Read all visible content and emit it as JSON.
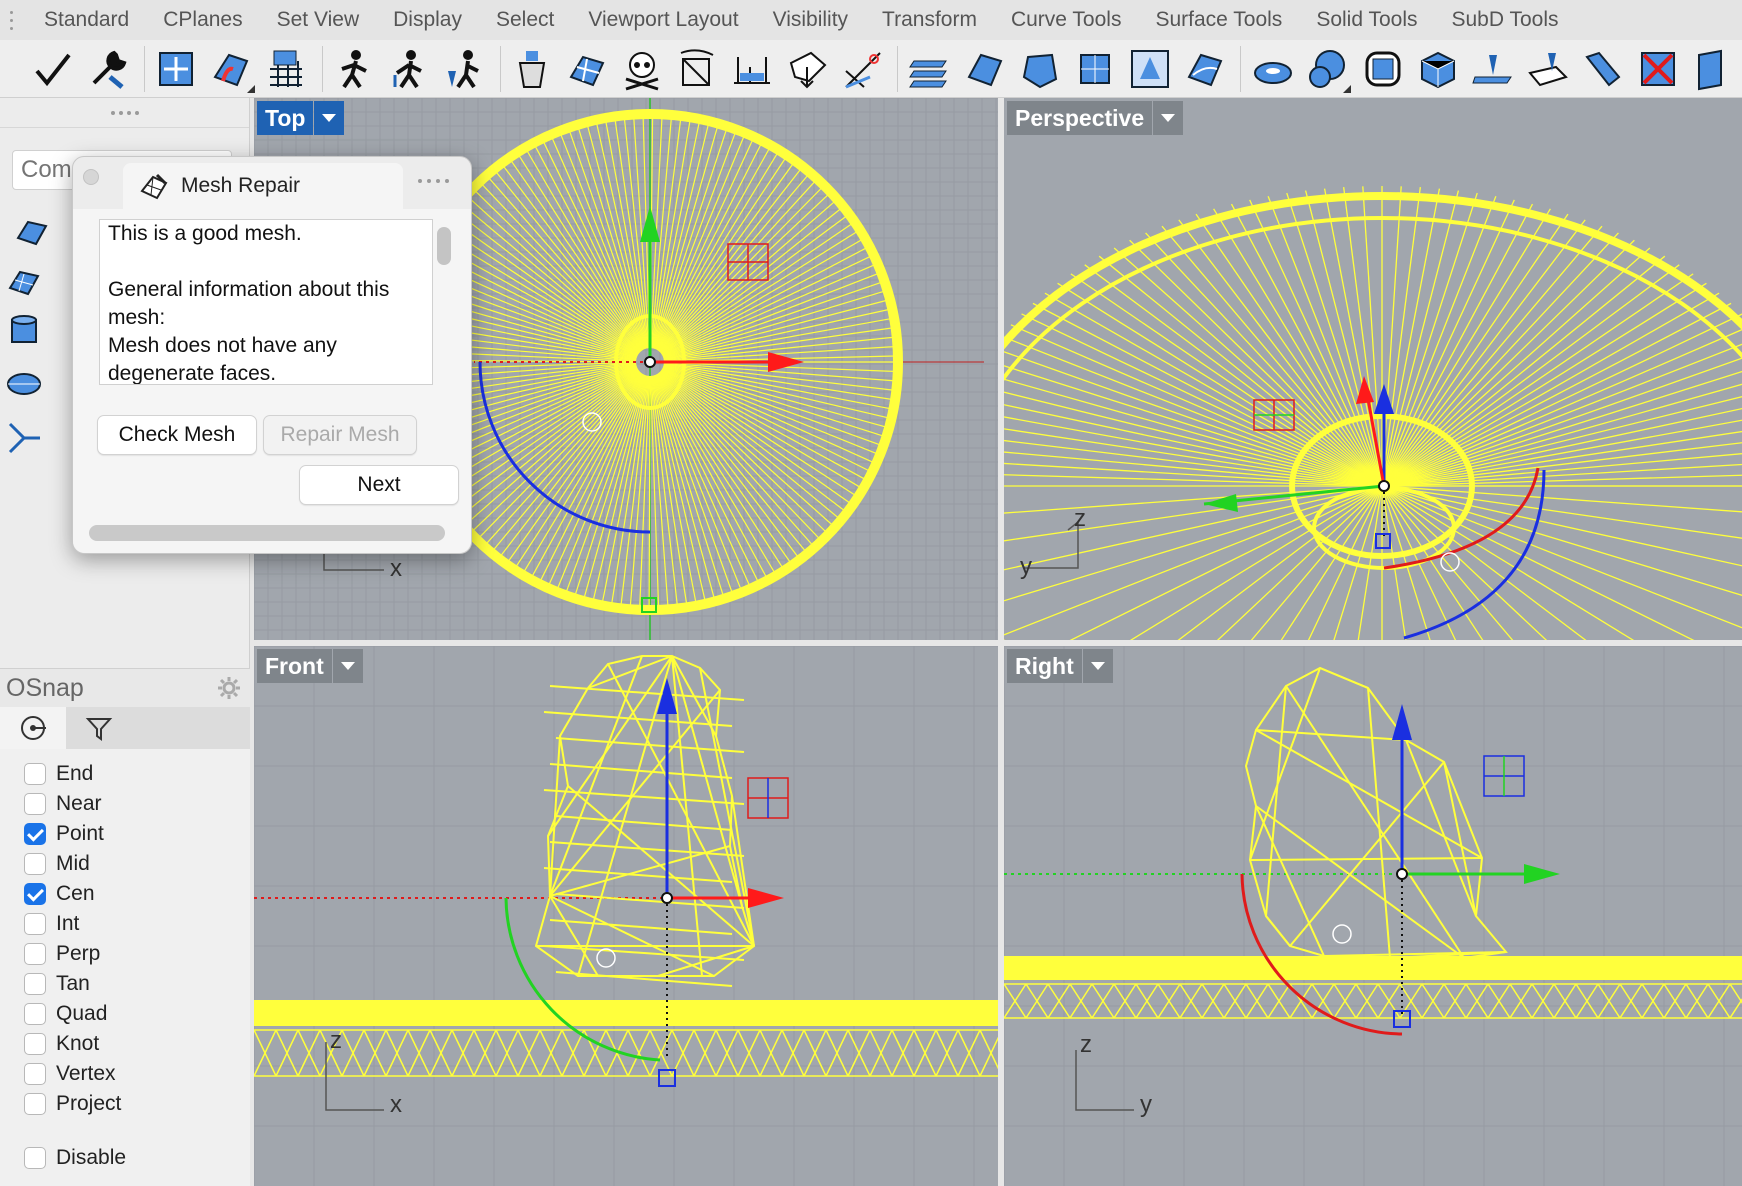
{
  "tabs": [
    "Standard",
    "CPlanes",
    "Set View",
    "Display",
    "Select",
    "Viewport Layout",
    "Visibility",
    "Transform",
    "Curve Tools",
    "Surface Tools",
    "Solid Tools",
    "SubD Tools"
  ],
  "toolbar_icons": [
    "checkmark-icon",
    "wrench-icon",
    "gumball-icon",
    "paint-surface-icon",
    "grid-snap-icon",
    "person-move-icon",
    "person-scale-icon",
    "person-rotate-icon",
    "bucket-icon",
    "mesh-patch-icon",
    "skull-icon",
    "frame-icon",
    "dimension-icon",
    "surface-outline-icon",
    "cut-icon",
    "mesh-layers-icon",
    "mesh-tile-icon",
    "mesh-shape-icon",
    "mesh-box-icon",
    "mesh-select-icon",
    "mesh-curve-icon",
    "torus-icon",
    "sphere-icon",
    "box-icon",
    "cube-mesh-icon",
    "plane-point-icon",
    "plane-flip-icon",
    "bend-icon",
    "red-cross-icon",
    "slab-icon"
  ],
  "sidebar": {
    "command_placeholder": "Com",
    "tools": [
      "surface-icon",
      "mesh-plane-icon",
      "cylinder-icon",
      "ellipsoid-icon",
      "scale-axis-icon"
    ]
  },
  "osnap": {
    "title": "OSnap",
    "items": [
      {
        "label": "End",
        "checked": false
      },
      {
        "label": "Near",
        "checked": false
      },
      {
        "label": "Point",
        "checked": true
      },
      {
        "label": "Mid",
        "checked": false
      },
      {
        "label": "Cen",
        "checked": true
      },
      {
        "label": "Int",
        "checked": false
      },
      {
        "label": "Perp",
        "checked": false
      },
      {
        "label": "Tan",
        "checked": false
      },
      {
        "label": "Quad",
        "checked": false
      },
      {
        "label": "Knot",
        "checked": false
      },
      {
        "label": "Vertex",
        "checked": false
      },
      {
        "label": "Project",
        "checked": false
      }
    ],
    "disable_label": "Disable"
  },
  "viewports": {
    "top": {
      "label": "Top",
      "axes": [
        "x"
      ]
    },
    "perspective": {
      "label": "Perspective",
      "axes": [
        "y",
        "z"
      ]
    },
    "front": {
      "label": "Front",
      "axes": [
        "z",
        "x"
      ]
    },
    "right": {
      "label": "Right",
      "axes": [
        "z",
        "y"
      ]
    }
  },
  "dialog": {
    "title": "Mesh Repair",
    "report": "This is a good mesh.\n\nGeneral information about this mesh:\n  Mesh does not have any degenerate faces.",
    "check_button": "Check Mesh",
    "repair_button": "Repair Mesh",
    "next_button": "Next"
  },
  "colors": {
    "wire": "#ffff3c",
    "active_viewport": "#1f62b3",
    "viewport_bg": "#a1a6ad",
    "axis_x": "#ff1a1a",
    "axis_y": "#22d322",
    "axis_z": "#1a2fe0",
    "check_blue": "#1a73e8"
  }
}
